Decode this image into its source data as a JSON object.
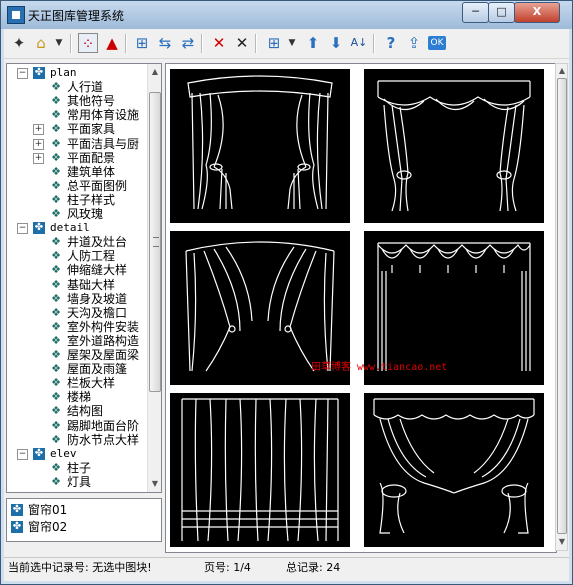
{
  "window": {
    "title": "天正图库管理系统",
    "min_glyph": "─",
    "max_glyph": "□",
    "close_glyph": "X"
  },
  "toolbar": {
    "icons": [
      "new-icon",
      "open-folder-icon",
      "dropdown-arrow-icon",
      "grid-select-icon",
      "triangle-icon",
      "refresh-icon",
      "replace-icon",
      "move-icon",
      "delete-icon",
      "close-icon",
      "view-layout-icon",
      "dropdown-arrow-icon",
      "move-up-icon",
      "move-down-icon",
      "sort-az-icon",
      "help-icon",
      "export-icon",
      "ok-icon"
    ],
    "glyphs": {
      "new": "✦",
      "open": "⌂",
      "dd": "▼",
      "grid": "⁘",
      "triangle": "▲",
      "refresh": "⊞",
      "replace": "⇆",
      "move": "⇄",
      "delete": "✕",
      "close": "✕",
      "layout": "⊞",
      "up": "⬆",
      "down": "⬇",
      "sort": "A↓",
      "help": "?",
      "export": "⇪",
      "ok": "OK"
    }
  },
  "tree": {
    "categories": [
      {
        "label": "plan",
        "items": [
          "人行道",
          "其他符号",
          "常用体育设施",
          "平面家具",
          "平面洁具与厨",
          "平面配景",
          "建筑单体",
          "总平面图例",
          "柱子样式",
          "风玫瑰"
        ],
        "expandable": [
          3,
          4,
          5
        ]
      },
      {
        "label": "detail",
        "items": [
          "井道及灶台",
          "人防工程",
          "伸缩缝大样",
          "基础大样",
          "墙身及坡道",
          "天沟及檐口",
          "室外构件安装",
          "室外道路构造",
          "屋架及屋面梁",
          "屋面及雨篷",
          "栏板大样",
          "楼梯",
          "结构图",
          "踢脚地面台阶",
          "防水节点大样"
        ]
      },
      {
        "label": "elev",
        "items": [
          "柱子",
          "灯具"
        ]
      }
    ]
  },
  "selected_list": {
    "items": [
      "窗帘01",
      "窗帘02"
    ]
  },
  "gallery": {
    "watermark": "田草博客 www.tiancao.net"
  },
  "status": {
    "current_record": "当前选中记录号: 无选中图块!",
    "page": "页号: 1/4",
    "total": "总记录:  24"
  },
  "colors": {
    "accent": "#2a6fb0",
    "thumb_bg": "#000000",
    "line": "#ffffff",
    "watermark": "#e00000"
  }
}
